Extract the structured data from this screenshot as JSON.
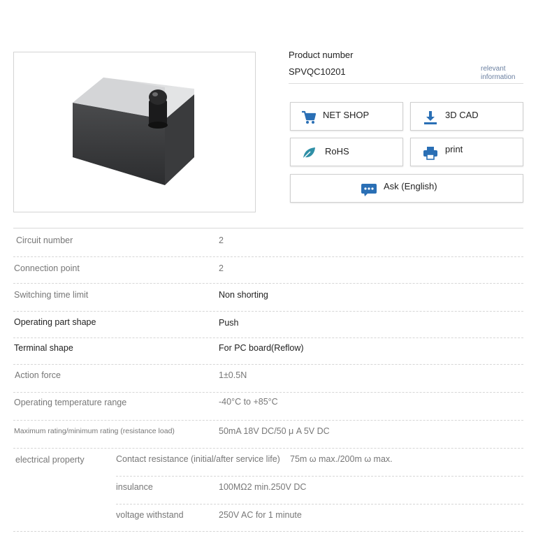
{
  "product": {
    "number_label": "Product number",
    "number_value": "SPVQC10201",
    "relevant_link": "relevant information",
    "image_alt": "detector switch product photo"
  },
  "actions": {
    "net_shop": "NET SHOP",
    "cad": "3D CAD",
    "rohs": "RoHS",
    "print": "print",
    "ask": "Ask (English)"
  },
  "icons": {
    "net_shop": "shopping-cart-icon",
    "cad": "download-icon",
    "rohs": "leaf-icon",
    "print": "printer-icon",
    "ask": "chat-bubble-icon"
  },
  "colors": {
    "accent_blue": "#2a6fb5",
    "rohs_teal": "#2f8fa6"
  },
  "specs": [
    {
      "label": "Circuit number",
      "value": "2"
    },
    {
      "label": "Connection point",
      "value": "2"
    },
    {
      "label": "Switching time limit",
      "value": "Non shorting"
    },
    {
      "label": "Operating part shape",
      "value": "Push"
    },
    {
      "label": "Terminal shape",
      "value": "For PC board(Reflow)"
    },
    {
      "label": "Action force",
      "value": "1±0.5N"
    },
    {
      "label": "Operating temperature range",
      "value": "-40°C to +85°C"
    },
    {
      "label": "Maximum rating/minimum rating (resistance load)",
      "value": "50mA 18V DC/50 μ A 5V DC"
    }
  ],
  "electrical": {
    "label": "electrical property",
    "rows": [
      {
        "label": "Contact resistance (initial/after service life)",
        "value": "75m ω max./200m ω max."
      },
      {
        "label": "insulance",
        "value": "100MΩ2 min.250V DC"
      },
      {
        "label": "voltage withstand",
        "value": "250V AC for 1 minute"
      }
    ]
  }
}
